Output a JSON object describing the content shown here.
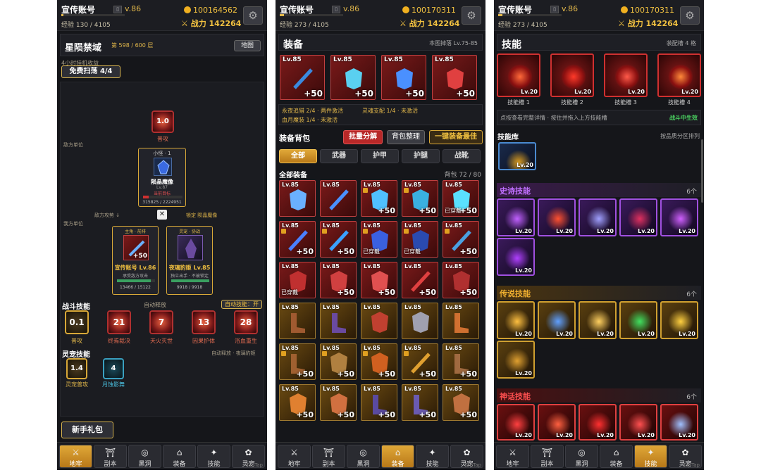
{
  "header1": {
    "username": "宣传账号",
    "vip": "v.86",
    "xp": "经验 130 / 4105",
    "gold": "100164562",
    "power": "战力 142264"
  },
  "header2": {
    "username": "宣传账号",
    "vip": "v.86",
    "xp": "经验 273 / 4105",
    "gold": "100170311",
    "power": "战力 142264"
  },
  "header3": {
    "username": "宣传账号",
    "vip": "v.86",
    "xp": "经验 273 / 4105",
    "gold": "100170311",
    "power": "战力 142264"
  },
  "dungeon": {
    "title": "星陨禁域",
    "floor": "第 598 / 600 层",
    "map_btn": "地图",
    "offline": "4小时挂机收益",
    "sweep_btn": "免费扫荡 4/4",
    "enemy_unit": "敌方单位",
    "attack_timer": "1.0",
    "attack_label": "普攻",
    "enemy_card": {
      "tag": "小怪 · 1",
      "name": "陨晶魔像",
      "level": "Lv.87",
      "status": "当前目标",
      "hp": "315825 / 2224951",
      "hp_fraction": 0.14
    },
    "enemy_atk": "敌方攻势 ↓",
    "lock": "锁定 陨晶魔像",
    "my_unit": "我方单位",
    "hero_card": {
      "tag": "主角 · 前排",
      "name": "宣传账号 Lv.86",
      "sub": "承受敌方攻击",
      "hp": "13466 / 15122",
      "hp_fraction": 0.89,
      "plus": "+50"
    },
    "pet_card": {
      "tag": "灵宠 · 协战",
      "name": "夜璃豹姬 Lv.85",
      "sub": "独立出手 · 不被锁定",
      "hp": "9918 / 9918",
      "hp_fraction": 1.0
    },
    "battle_skills_title": "战斗技能",
    "auto_release": "自动释放",
    "auto_toggle": "自动技能：开",
    "skills": [
      {
        "value": "0.1",
        "label": "普攻"
      },
      {
        "value": "21",
        "label": "终焉裁决"
      },
      {
        "value": "7",
        "label": "天火灭世"
      },
      {
        "value": "13",
        "label": "因果护体"
      },
      {
        "value": "28",
        "label": "浴血重生"
      }
    ],
    "pet_skills_title": "灵宠技能",
    "pet_auto": "自动释放 · 夜璃豹姬",
    "pet_skills": [
      {
        "value": "1.4",
        "label": "灵宠普攻"
      },
      {
        "value": "4",
        "label": "月蚀影舞"
      }
    ],
    "gift_btn": "新手礼包"
  },
  "equipment": {
    "title": "装备",
    "drop": "本图掉落 Lv.75-85",
    "equipped": [
      {
        "lv": "Lv.85",
        "plus": "+50"
      },
      {
        "lv": "Lv.85",
        "plus": "+50"
      },
      {
        "lv": "Lv.85",
        "plus": "+50"
      },
      {
        "lv": "Lv.85",
        "plus": "+50"
      }
    ],
    "set_line1a": "永夜追猎 2/4 · 两件激活",
    "set_line1b": "灵魂支配 1/4 · 未激活",
    "set_line2": "血月魔装 1/4 · 未激活",
    "bag_title": "装备背包",
    "btn_decompose": "批量分解",
    "btn_sort": "背包整理",
    "btn_best": "一键装备最佳",
    "filters": [
      "全部",
      "武器",
      "护甲",
      "护腿",
      "战靴"
    ],
    "list_title": "全部装备",
    "bag_count": "背包 72 / 80",
    "worn": "已穿戴"
  },
  "skills_page": {
    "title": "技能",
    "slots_info": "装配槽 4 格",
    "slots": [
      {
        "lv": "Lv.20",
        "label": "技能槽 1"
      },
      {
        "lv": "Lv.20",
        "label": "技能槽 2"
      },
      {
        "lv": "Lv.20",
        "label": "技能槽 3"
      },
      {
        "lv": "Lv.20",
        "label": "技能槽 4"
      }
    ],
    "hint": "点按查看完整详情 · 按住并拖入上方技能槽",
    "in_effect": "战斗中生效",
    "library": "技能库",
    "sort": "按品质分区排列",
    "lv": "Lv.20",
    "cats": [
      {
        "name": "史诗技能",
        "count": "6个",
        "color": "#c070ff"
      },
      {
        "name": "传说技能",
        "count": "6个",
        "color": "#f0b030"
      },
      {
        "name": "神话技能",
        "count": "6个",
        "color": "#ff5050"
      }
    ]
  },
  "nav": [
    "地牢",
    "副本",
    "黑洞",
    "装备",
    "技能",
    "灵宠"
  ],
  "nav_icons": [
    "sword-icon",
    "gate-icon",
    "vortex-icon",
    "armor-icon",
    "star-icon",
    "paw-icon"
  ],
  "watermark": "TapTap"
}
